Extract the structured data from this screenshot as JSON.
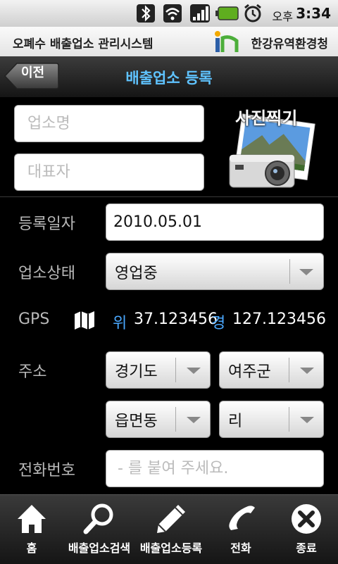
{
  "status_bar": {
    "ampm": "오후",
    "time": "3:34",
    "icons": [
      "bluetooth-icon",
      "wifi-icon",
      "signal-icon",
      "battery-icon",
      "alarm-icon"
    ]
  },
  "title_bar": {
    "app_name": "오폐수 배출업소 관리시스템",
    "org_name": "한강유역환경청"
  },
  "nav": {
    "back_label": "이전",
    "title": "배출업소 등록"
  },
  "form": {
    "business_name_placeholder": "업소명",
    "representative_placeholder": "대표자",
    "camera_label": "사진찍기",
    "reg_date_label": "등록일자",
    "reg_date_value": "2010.05.01",
    "status_label": "업소상태",
    "status_value": "영업중",
    "gps_label": "GPS",
    "lat_key": "위",
    "lat_value": "37.123456",
    "lon_key": "경",
    "lon_value": "127.123456",
    "address_label": "주소",
    "province": "경기도",
    "county": "여주군",
    "town": "읍면동",
    "village": "리",
    "phone_label": "전화번호",
    "phone_placeholder": "- 를 붙여 주세요."
  },
  "bottom_tabs": [
    {
      "label": "홈",
      "icon": "home-icon"
    },
    {
      "label": "배출업소검색",
      "icon": "search-icon"
    },
    {
      "label": "배출업소등록",
      "icon": "pencil-icon"
    },
    {
      "label": "전화",
      "icon": "phone-icon"
    },
    {
      "label": "종료",
      "icon": "close-icon"
    }
  ]
}
